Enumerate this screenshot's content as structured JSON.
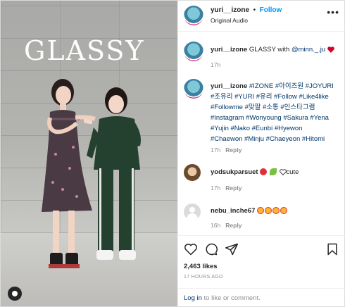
{
  "post": {
    "username": "yuri__izone",
    "follow_label": "Follow",
    "audio_label": "Original Audio",
    "more_label": "•••",
    "media_title": "GLASSY"
  },
  "comments": [
    {
      "username": "yuri__izone",
      "text": "GLASSY with",
      "mention": "@minn._.ju",
      "trailing_icon": "heart-emoji",
      "meta_time": "17h"
    },
    {
      "username": "yuri__izone",
      "tags_line1": "#IZONE #아이즈원 #JOYURI",
      "tags_line2": "#조유리 #YURI #유리 #Follow #Like4like",
      "tags_line3": "#Followme #맞팔 #소통 #인스타그램",
      "tags_line4": "#Instagram #Wonyoung #Sakura #Yena",
      "tags_line5": "#Yujin #Nako #Eunbi #Hyewon",
      "tags_line6": "#Chaewon #Minju #Chaeyeon #Hitomi",
      "meta_time": "17h",
      "reply_label": "Reply"
    },
    {
      "username": "yodsukparsuet",
      "text": "cute",
      "emojis": [
        "strawberry-emoji",
        "sprout-emoji",
        "heart-outline-emoji"
      ],
      "meta_time": "17h",
      "reply_label": "Reply"
    },
    {
      "username": "nebu_inche67",
      "emojis": [
        "heart-eyes-emoji",
        "heart-eyes-emoji",
        "heart-eyes-emoji",
        "heart-eyes-emoji"
      ],
      "meta_time": "16h",
      "reply_label": "Reply"
    }
  ],
  "footer": {
    "likes": "2,463 likes",
    "timestamp": "17 HOURS AGO",
    "login_link": "Log in",
    "login_text": " to like or comment."
  },
  "colors": {
    "link_blue": "#0095f6",
    "tag_blue": "#00376b",
    "muted": "#8e8e8e",
    "heart_red": "#ed4956"
  }
}
